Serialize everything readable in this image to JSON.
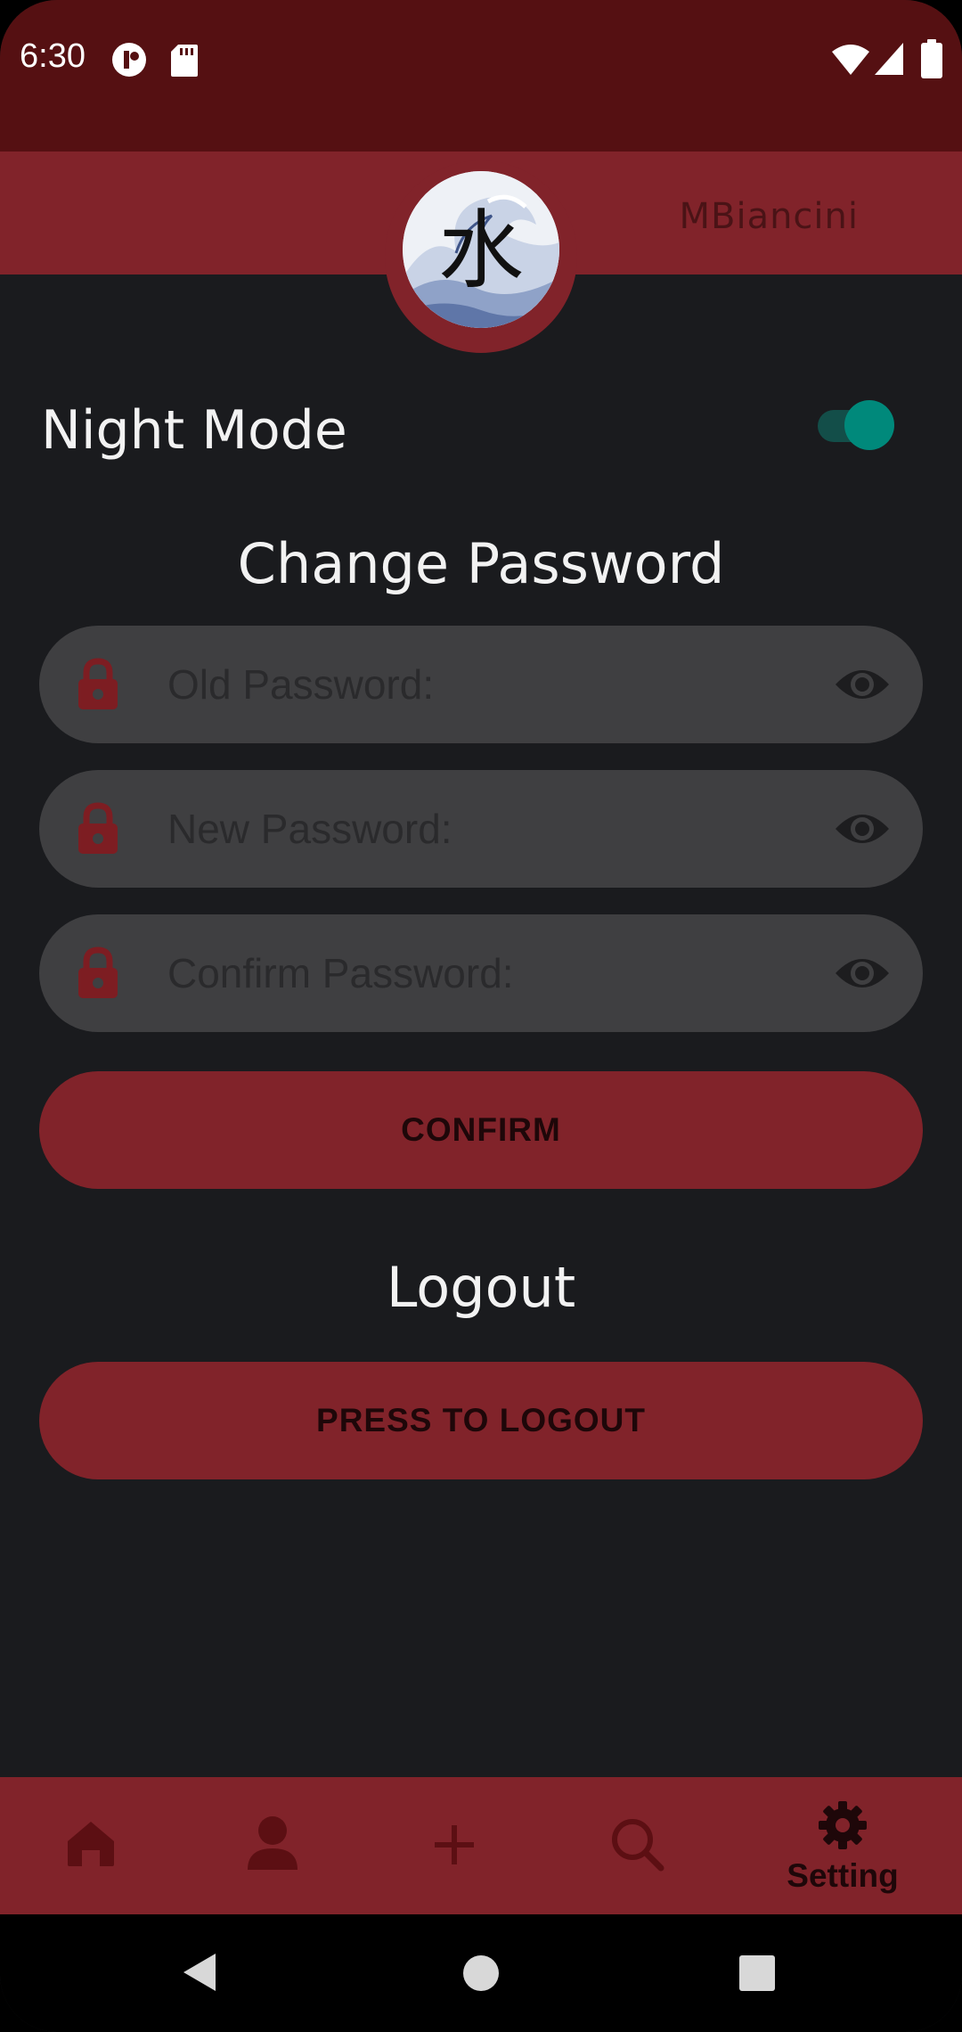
{
  "status_bar": {
    "time": "6:30",
    "icons": [
      "notification-icon",
      "sd-card-icon",
      "wifi-icon",
      "signal-icon",
      "battery-icon"
    ]
  },
  "header": {
    "username": "MBiancini",
    "avatar": "wave-kanji-avatar",
    "avatar_text": "水"
  },
  "settings": {
    "night_mode_label": "Night Mode",
    "night_mode_enabled": true,
    "change_password_title": "Change Password",
    "fields": [
      {
        "placeholder": "Old Password:",
        "value": ""
      },
      {
        "placeholder": "New Password:",
        "value": ""
      },
      {
        "placeholder": "Confirm Password:",
        "value": ""
      }
    ],
    "confirm_label": "CONFIRM",
    "logout_title": "Logout",
    "logout_label": "PRESS TO LOGOUT"
  },
  "bottom_nav": {
    "items": [
      {
        "icon": "home-icon",
        "label": ""
      },
      {
        "icon": "profile-icon",
        "label": ""
      },
      {
        "icon": "add-icon",
        "label": ""
      },
      {
        "icon": "search-icon",
        "label": ""
      },
      {
        "icon": "gear-icon",
        "label": "Setting",
        "active": true
      }
    ]
  },
  "colors": {
    "background": "#1a1b1e",
    "status_bar": "#551012",
    "accent": "#81232a",
    "field": "#3f3f41",
    "toggle": "#00897b"
  }
}
